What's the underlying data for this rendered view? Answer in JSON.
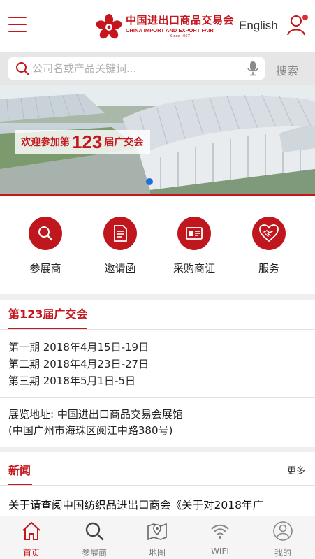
{
  "header": {
    "logo_cn": "中国进出口商品交易会",
    "logo_en": "CHINA IMPORT AND EXPORT FAIR",
    "logo_since": "Since 1957",
    "language_label": "English"
  },
  "search": {
    "placeholder": "公司名或产品关键词...",
    "button_label": "搜索"
  },
  "banner": {
    "prefix": "欢迎参加第",
    "number": "123",
    "suffix": "届广交会"
  },
  "quick_menu": {
    "items": [
      {
        "label": "参展商",
        "icon": "search-icon"
      },
      {
        "label": "邀请函",
        "icon": "document-icon"
      },
      {
        "label": "采购商证",
        "icon": "id-card-icon"
      },
      {
        "label": "服务",
        "icon": "handshake-heart-icon"
      }
    ]
  },
  "fair": {
    "title": "第123届广交会",
    "phases": [
      "第一期 2018年4月15日-19日",
      "第二期 2018年4月23日-27日",
      "第三期 2018年5月1日-5日"
    ],
    "address_line1": "展览地址: 中国进出口商品交易会展馆",
    "address_line2": "(中国广州市海珠区阅江中路380号)"
  },
  "news": {
    "title": "新闻",
    "more_label": "更多",
    "items": [
      {
        "title": "关于请查阅中国纺织品进出口商会《关于对2018年广"
      }
    ]
  },
  "bottom_nav": {
    "items": [
      {
        "label": "首页",
        "icon": "home-icon",
        "active": true
      },
      {
        "label": "参展商",
        "icon": "search-icon",
        "active": false
      },
      {
        "label": "地图",
        "icon": "map-icon",
        "active": false
      },
      {
        "label": "WIFI",
        "icon": "wifi-icon",
        "active": false
      },
      {
        "label": "我的",
        "icon": "user-icon",
        "active": false
      }
    ]
  },
  "colors": {
    "brand_red": "#c4161c",
    "banner_dot": "#1f6fd8",
    "nav_bg": "#f5f5f5"
  }
}
